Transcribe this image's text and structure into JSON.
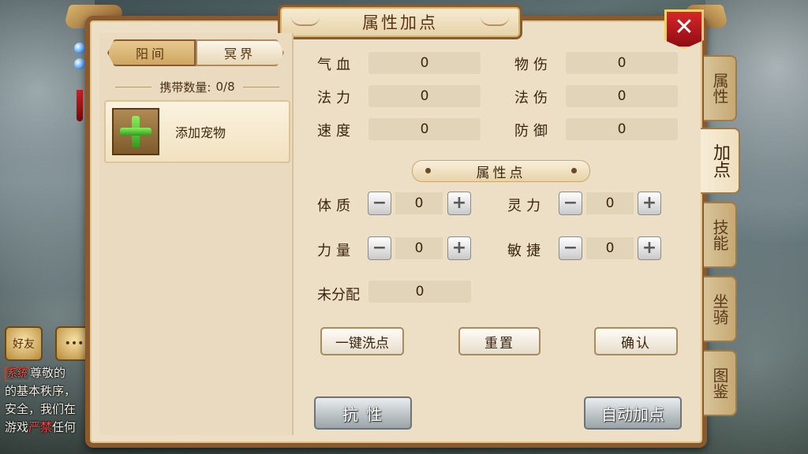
{
  "title": "属性加点",
  "close_label": "✕",
  "realm_tabs": [
    {
      "label": "阳间",
      "active": true
    },
    {
      "label": "冥界",
      "active": false
    }
  ],
  "carry": {
    "label": "携带数量:",
    "value": "0/8"
  },
  "add_pet_label": "添加宠物",
  "stats": {
    "qixue": {
      "label": "气血",
      "value": "0"
    },
    "wushang": {
      "label": "物伤",
      "value": "0"
    },
    "fali": {
      "label": "法力",
      "value": "0"
    },
    "fashang": {
      "label": "法伤",
      "value": "0"
    },
    "sudu": {
      "label": "速度",
      "value": "0"
    },
    "fangyu": {
      "label": "防御",
      "value": "0"
    }
  },
  "points_section_title": "属性点",
  "points": {
    "tizhi": {
      "label": "体质",
      "value": "0"
    },
    "lingli": {
      "label": "灵力",
      "value": "0"
    },
    "liliang": {
      "label": "力量",
      "value": "0"
    },
    "minjie": {
      "label": "敏捷",
      "value": "0"
    }
  },
  "unallocated": {
    "label": "未分配",
    "value": "0"
  },
  "stepper": {
    "minus": "−",
    "plus": "+"
  },
  "buttons": {
    "wash": "一键洗点",
    "reset": "重置",
    "confirm": "确认",
    "resist": "抗 性",
    "auto": "自动加点"
  },
  "side_tabs": [
    {
      "label": "属性",
      "active": false
    },
    {
      "label": "加点",
      "active": true
    },
    {
      "label": "技能",
      "active": false
    },
    {
      "label": "坐骑",
      "active": false
    },
    {
      "label": "图鉴",
      "active": false
    }
  ],
  "chat": {
    "friends_label": "好友",
    "message_icon": "chat-bubble-icon",
    "system_tag": "系统",
    "line1": "尊敬的",
    "line2": "的基本秩序，",
    "line3": "安全，我们在",
    "line4a": "游戏",
    "line4_warn": "严禁",
    "line4b": "任何"
  },
  "colors": {
    "panel_bg": "#ecdfc5",
    "frame": "#8a5a2e",
    "close_red": "#c8191f",
    "plus_green": "#4cc531",
    "warn_red": "#ff4a4a"
  }
}
